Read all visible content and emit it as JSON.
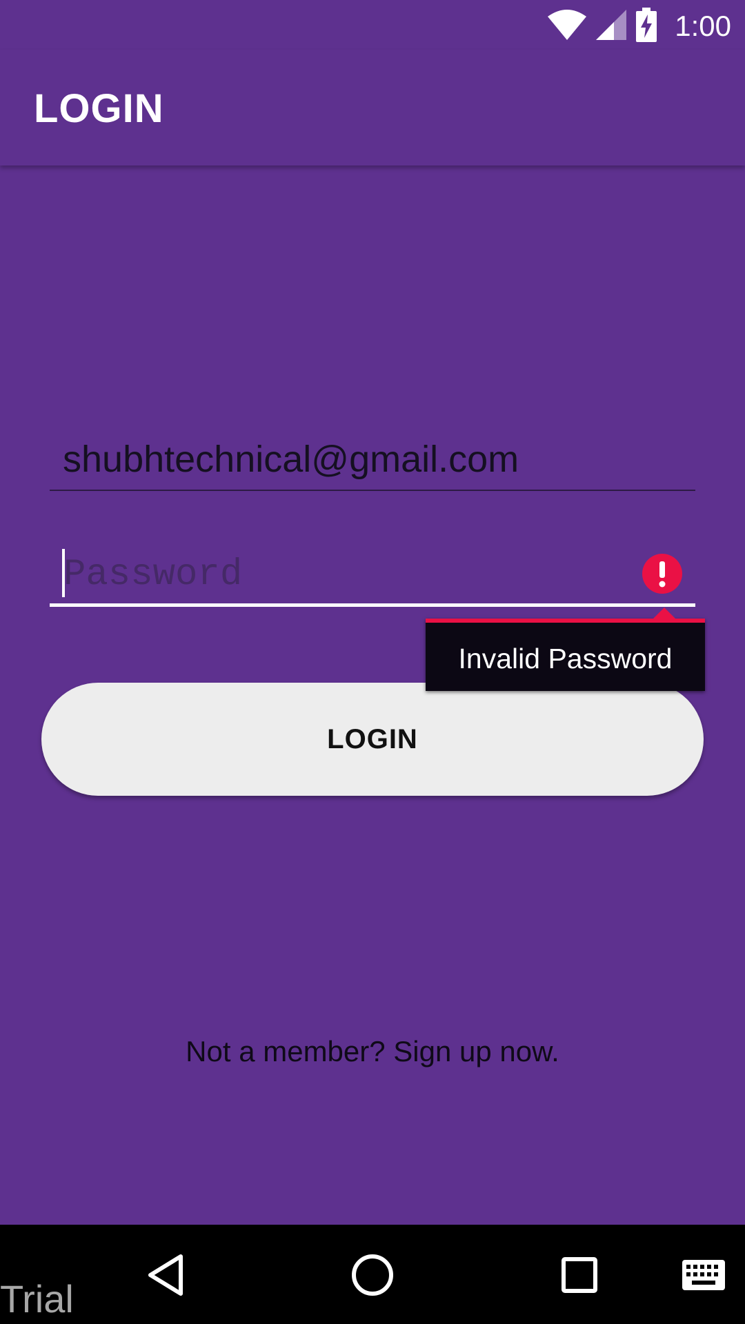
{
  "status_bar": {
    "time": "1:00",
    "icons": [
      "wifi-icon",
      "cell-signal-icon",
      "battery-charging-icon"
    ]
  },
  "app_bar": {
    "title": "LOGIN"
  },
  "form": {
    "email": {
      "value": "shubhtechnical@gmail.com",
      "placeholder": ""
    },
    "password": {
      "value": "",
      "placeholder": "Password",
      "error_icon": "error-alert-icon",
      "error_message": "Invalid Password"
    },
    "login_button_label": "LOGIN",
    "signup_text": "Not a member? Sign up now."
  },
  "nav_bar": {
    "buttons": [
      "back-icon",
      "home-icon",
      "recents-icon",
      "keyboard-icon"
    ]
  },
  "watermark": "Trial",
  "colors": {
    "background": "#5e318f",
    "error": "#ea1145",
    "button": "#ededed",
    "tooltip": "#0c0814"
  }
}
